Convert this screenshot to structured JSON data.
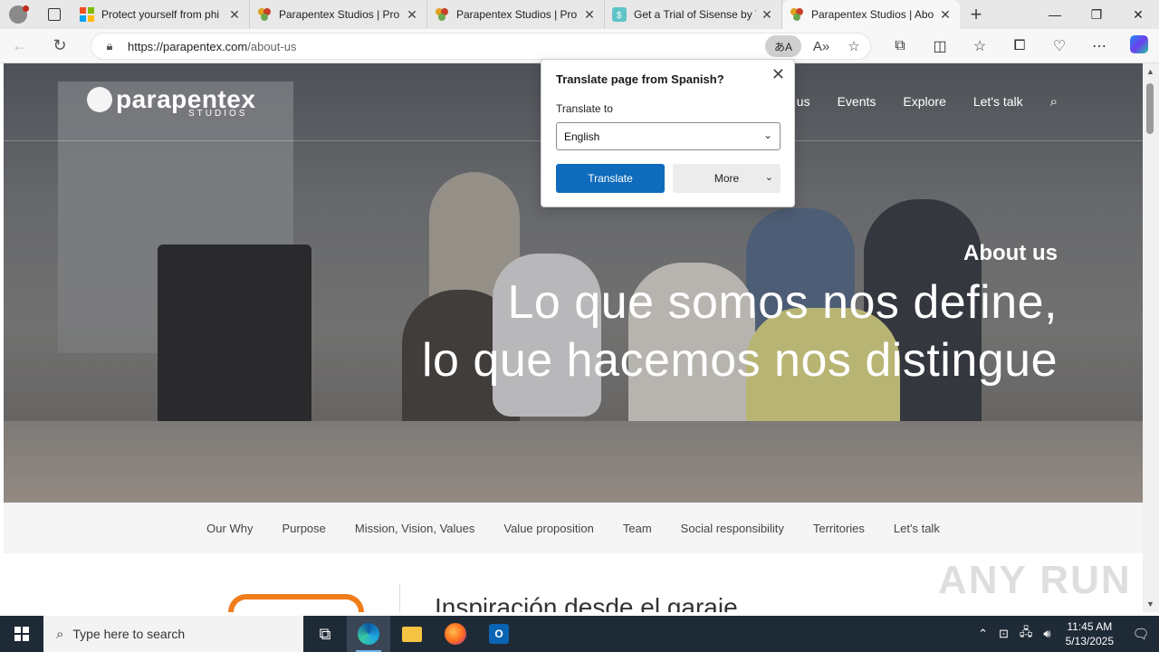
{
  "browser": {
    "tabs": [
      {
        "title": "Protect yourself from phi",
        "favicon": "microsoft-logo-icon",
        "active": false
      },
      {
        "title": "Parapentex Studios | Pro",
        "favicon": "parapentex-favicon-icon",
        "active": false
      },
      {
        "title": "Parapentex Studios | Pro",
        "favicon": "parapentex-favicon-icon",
        "active": false
      },
      {
        "title": "Get a Trial of Sisense by T",
        "favicon": "sisense-favicon-icon",
        "active": false
      },
      {
        "title": "Parapentex Studios | Abo",
        "favicon": "parapentex-favicon-icon",
        "active": true
      }
    ],
    "url_host": "https://parapentex.com",
    "url_path": "/about-us"
  },
  "site": {
    "logo_name": "parapentex",
    "logo_sub": "STUDIOS",
    "menu": [
      "t us",
      "Events",
      "Explore",
      "Let's talk"
    ],
    "hero_eyebrow": "About us",
    "hero_line1": "Lo que somos nos define,",
    "hero_line2": "lo que hacemos nos distingue",
    "subnav": [
      "Our Why",
      "Purpose",
      "Mission, Vision, Values",
      "Value proposition",
      "Team",
      "Social responsibility",
      "Territories",
      "Let's talk"
    ],
    "section_heading": "Inspiración desde el garaje"
  },
  "translate_popup": {
    "title": "Translate page from Spanish?",
    "label": "Translate to",
    "selected_language": "English",
    "translate_button": "Translate",
    "more_button": "More"
  },
  "taskbar": {
    "search_placeholder": "Type here to search",
    "time": "11:45 AM",
    "date": "5/13/2025"
  },
  "watermark": "ANY RUN",
  "colors": {
    "accent": "#0f6cbd",
    "orange": "#f07c1a",
    "taskbar": "#1f2a37"
  }
}
